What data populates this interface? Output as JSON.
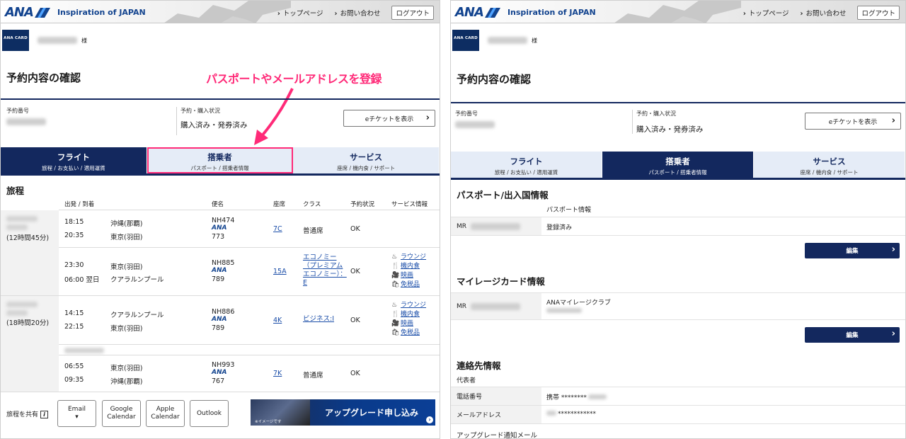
{
  "brand": {
    "logo_text": "ANA",
    "tagline": "Inspiration of JAPAN"
  },
  "header": {
    "link_top": "トップページ",
    "link_contact": "お問い合わせ",
    "logout": "ログアウト"
  },
  "user": {
    "card_label": "ANA CARD",
    "honorific": "様"
  },
  "page_title": "予約内容の確認",
  "annotation": "パスポートやメールアドレスを登録",
  "booking": {
    "number_label": "予約番号",
    "status_label": "予約・購入状況",
    "status_value": "購入済み・発券済み",
    "eticket_button": "eチケットを表示"
  },
  "tabs": [
    {
      "title": "フライト",
      "subtitle": "旅程 / お支払い / 適用運賃"
    },
    {
      "title": "搭乗者",
      "subtitle": "パスポート / 搭乗者情報"
    },
    {
      "title": "サービス",
      "subtitle": "座席 / 機内食 / サポート"
    }
  ],
  "itinerary": {
    "heading": "旅程",
    "columns": {
      "depart_arrive": "出発 / 到着",
      "flight": "便名",
      "seat": "座席",
      "class": "クラス",
      "status": "予約状況",
      "service": "サービス情報"
    },
    "journeys": [
      {
        "duration": "(12時間45分)",
        "segments": [
          {
            "dep_time": "18:15",
            "dep_city": "沖縄(那覇)",
            "arr_time": "20:35",
            "arr_city": "東京(羽田)",
            "flight_no": "NH474",
            "carrier": "ANA",
            "aircraft": "773",
            "seat": "7C",
            "class": "普通席",
            "status": "OK",
            "services": []
          },
          {
            "dep_time": "23:30",
            "dep_city": "東京(羽田)",
            "arr_time": "06:00 翌日",
            "arr_city": "クアラルンプール",
            "flight_no": "NH885",
            "carrier": "ANA",
            "aircraft": "789",
            "seat": "15A",
            "class_lines": [
              "エコノミー",
              "（プレミアム",
              "エコノミー）：",
              "E"
            ],
            "status": "OK",
            "services": [
              "ラウンジ",
              "機内食",
              "映画",
              "免税品"
            ]
          }
        ]
      },
      {
        "duration": "(18時間20分)",
        "segments": [
          {
            "dep_time": "14:15",
            "dep_city": "クアラルンプール",
            "arr_time": "22:15",
            "arr_city": "東京(羽田)",
            "flight_no": "NH886",
            "carrier": "ANA",
            "aircraft": "789",
            "seat": "4K",
            "class": "ビジネス:I",
            "status": "OK",
            "services": [
              "ラウンジ",
              "機内食",
              "映画",
              "免税品"
            ]
          },
          {
            "dep_time": "06:55",
            "dep_city": "東京(羽田)",
            "arr_time": "09:35",
            "arr_city": "沖縄(那覇)",
            "flight_no": "NH993",
            "carrier": "ANA",
            "aircraft": "767",
            "seat": "7K",
            "class": "普通席",
            "status": "OK",
            "services": []
          }
        ]
      }
    ]
  },
  "share": {
    "label": "旅程を共有",
    "buttons": [
      {
        "lines": [
          "Email",
          "▾"
        ]
      },
      {
        "lines": [
          "Google",
          "Calendar"
        ]
      },
      {
        "lines": [
          "Apple",
          "Calendar"
        ]
      },
      {
        "lines": [
          "Outlook"
        ]
      }
    ]
  },
  "upgrade_banner": {
    "text": "アップグレード申し込み",
    "note": "※イメージです"
  },
  "passenger": {
    "passport_heading": "パスポート/出入国情報",
    "passport_info_label": "パスポート情報",
    "title_mr": "MR",
    "passport_status": "登録済み",
    "edit_label": "編集",
    "mileage_heading": "マイレージカード情報",
    "mileage_club": "ANAマイレージクラブ",
    "contact_heading": "連絡先情報",
    "representative": "代表者",
    "phone_label": "電話番号",
    "phone_value": "携帯 ********",
    "email_label": "メールアドレス",
    "email_value": "************",
    "upgrade_notice": "アップグレード通知メール"
  },
  "colors": {
    "navy": "#13285e",
    "brand_blue": "#13448f",
    "highlight_pink": "#ff2a78",
    "tab_inactive": "#e5ecf7",
    "link_blue": "#1a4da8"
  }
}
